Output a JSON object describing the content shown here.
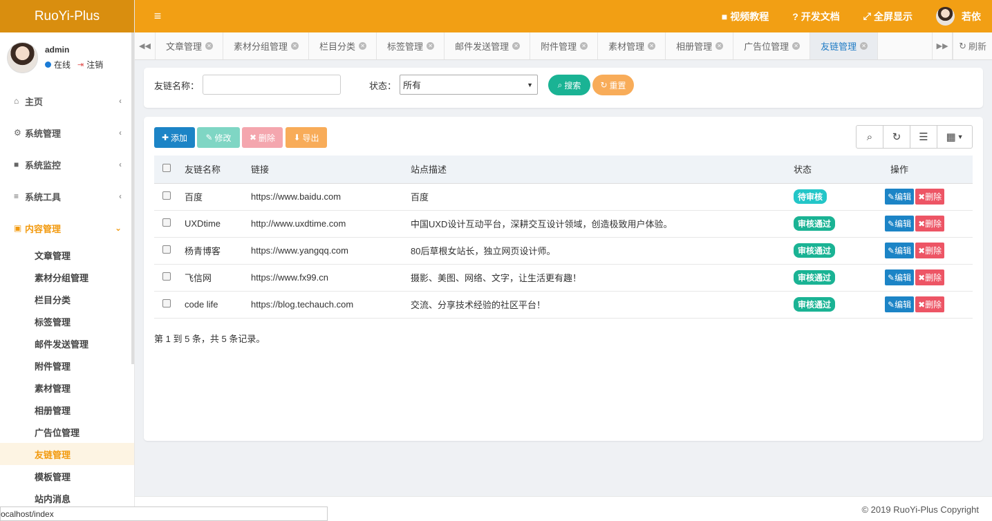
{
  "brand": "RuoYi-Plus",
  "user": {
    "name": "admin",
    "status": "在线",
    "logout": "注销"
  },
  "sidebar": {
    "items": [
      {
        "icon": "home-icon",
        "glyph": "⌂",
        "label": "主页"
      },
      {
        "icon": "gear-icon",
        "glyph": "⚙",
        "label": "系统管理"
      },
      {
        "icon": "video-icon",
        "glyph": "■",
        "label": "系统监控"
      },
      {
        "icon": "bars-icon",
        "glyph": "≡",
        "label": "系统工具"
      },
      {
        "icon": "picture-icon",
        "glyph": "▣",
        "label": "内容管理"
      }
    ],
    "sub_items": [
      "文章管理",
      "素材分组管理",
      "栏目分类",
      "标签管理",
      "邮件发送管理",
      "附件管理",
      "素材管理",
      "相册管理",
      "广告位管理",
      "友链管理",
      "模板管理",
      "站内消息"
    ]
  },
  "topbar": {
    "menu_glyph": "≡",
    "links": [
      {
        "icon": "video-icon",
        "glyph": "■",
        "label": "视频教程"
      },
      {
        "icon": "question-icon",
        "glyph": "?",
        "label": "开发文档"
      },
      {
        "icon": "fullscreen-icon",
        "glyph": "⤢",
        "label": "全屏显示"
      }
    ],
    "username": "若依"
  },
  "tabs": [
    "文章管理",
    "素材分组管理",
    "栏目分类",
    "标签管理",
    "邮件发送管理",
    "附件管理",
    "素材管理",
    "相册管理",
    "广告位管理",
    "友链管理"
  ],
  "tab_refresh": "刷新",
  "search": {
    "name_label": "友链名称：",
    "status_label": "状态：",
    "status_value": "所有",
    "search_btn": "搜索",
    "reset_btn": "重置"
  },
  "toolbar": {
    "add": "添加",
    "edit": "修改",
    "delete": "删除",
    "export": "导出"
  },
  "table": {
    "columns": [
      "友链名称",
      "链接",
      "站点描述",
      "状态",
      "操作"
    ],
    "rows": [
      {
        "name": "百度",
        "url": "https://www.baidu.com",
        "desc": "百度",
        "status": "待审核"
      },
      {
        "name": "UXDtime",
        "url": "http://www.uxdtime.com",
        "desc": "中国UXD设计互动平台，深耕交互设计领域，创造极致用户体验。",
        "status": "审核通过"
      },
      {
        "name": "杨青博客",
        "url": "https://www.yangqq.com",
        "desc": "80后草根女站长，独立网页设计师。",
        "status": "审核通过"
      },
      {
        "name": "飞信网",
        "url": "https://www.fx99.cn",
        "desc": "摄影、美图、网络、文字，让生活更有趣！",
        "status": "审核通过"
      },
      {
        "name": "code life",
        "url": "https://blog.techauch.com",
        "desc": "交流、分享技术经验的社区平台！",
        "status": "审核通过"
      }
    ],
    "edit_label": "编辑",
    "delete_label": "删除"
  },
  "pager": "第 1 到 5 条，共 5 条记录。",
  "footer": "© 2019 RuoYi-Plus Copyright",
  "statusbar": "ocalhost/index",
  "colors": {
    "topbar": "#f29f14",
    "brand_bg": "#d98e0f",
    "primary": "#1c84c6",
    "success": "#1ab394",
    "danger": "#ed5565",
    "warning": "#f8ac59"
  }
}
